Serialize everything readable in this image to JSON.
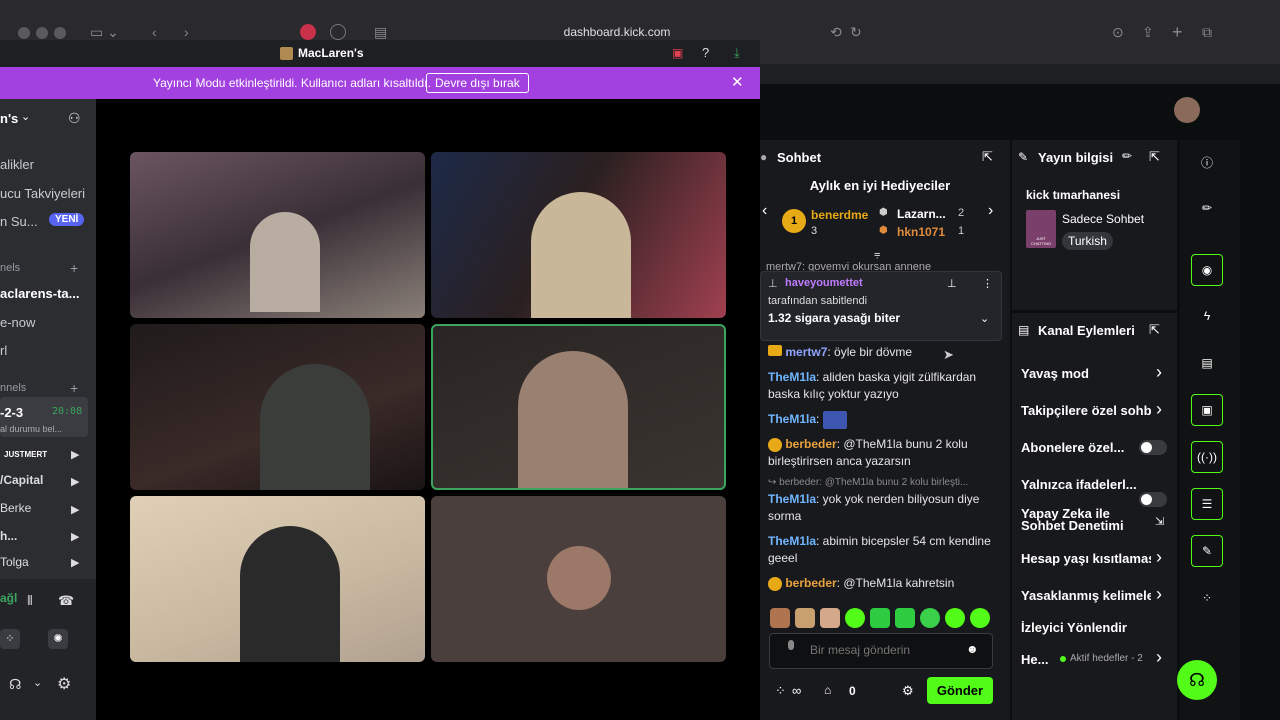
{
  "browser": {
    "url": "dashboard.kick.com"
  },
  "discord": {
    "window_title": "MacLaren's",
    "banner_text": "Yayıncı Modu etkinleştirildi. Kullanıcı adları kısaltıldı.",
    "banner_button": "Devre dışı bırak",
    "server_name": "n's",
    "sidebar": {
      "items": [
        "alikler",
        "ucu Takviyeleri",
        "n Su..."
      ],
      "new_badge": "YENİ",
      "section1": "nels",
      "channel_active": "aclarens-ta...",
      "ch2": "e-now",
      "ch3": "rl",
      "section2": "nnels",
      "voice_channel": "-2-3",
      "voice_time": "20:08",
      "voice_status": "al durumu bel...",
      "users": [
        "JUSTMERT",
        "/Capital",
        "Berke",
        "h...",
        "Tolga"
      ],
      "self_name": "ağl"
    }
  },
  "kick": {
    "chat": {
      "title": "Sohbet",
      "gifters_title": "Aylık en iyi Hediyeciler",
      "gifters": [
        {
          "rank": "1",
          "name": "benerdme",
          "count": "3"
        },
        {
          "rank": "2",
          "name": "Lazarn...",
          "count": "2"
        },
        {
          "rank": "3",
          "name": "hkn1071",
          "count": "1"
        }
      ],
      "partial_line": "mertw7: govemvi okursan annene",
      "pinned": {
        "user": "haveyoumettet",
        "by": "tarafından sabitlendi",
        "message": "1.32 sigara yasağı biter"
      },
      "messages": [
        {
          "user": "mertw7",
          "text": ": öyle bir dövme",
          "color": "#8fa4ff"
        },
        {
          "user": "TheM1la",
          "text": ": aliden baska yigit zülfikardan baska kılıç yoktur yazıyo",
          "color": "#6fb6ff"
        },
        {
          "user": "TheM1la",
          "text": ":",
          "color": "#6fb6ff"
        },
        {
          "user": "berbeder",
          "text": ": @TheM1la bunu 2 kolu birleştirirsen anca yazarsın",
          "color": "#e8a23d"
        },
        {
          "reply": "berbeder: @TheM1la bunu 2 kolu birleşti...",
          "user": "TheM1la",
          "text": ": yok yok nerden biliyosun diye sorma",
          "color": "#6fb6ff"
        },
        {
          "user": "TheM1la",
          "text": ": abimin bicepsler 54 cm kendine geeel",
          "color": "#6fb6ff"
        },
        {
          "user": "berbeder",
          "text": ": @TheM1la kahretsin",
          "color": "#e8a23d"
        }
      ],
      "input_placeholder": "Bir mesaj gönderin",
      "points": "0",
      "send_label": "Gönder"
    },
    "stream_info": {
      "title": "Yayın bilgisi",
      "stream_title": "kick tımarhanesi",
      "category": "Sadece Sohbet",
      "category_art_text": "JUST CHATTING",
      "language": "Turkish"
    },
    "actions": {
      "title": "Kanal Eylemleri",
      "items": [
        {
          "label": "Yavaş mod",
          "control": "chevron"
        },
        {
          "label": "Takipçilere özel sohbet",
          "control": "chevron"
        },
        {
          "label": "Abonelere özel...",
          "control": "toggle"
        },
        {
          "label": "Yalnızca ifadelerl...",
          "control": "toggle"
        },
        {
          "label": "Yapay Zeka ile Sohbet Denetimi",
          "control": "external"
        },
        {
          "label": "Hesap yaşı kısıtlaması",
          "control": "chevron"
        },
        {
          "label": "Yasaklanmış kelimeler",
          "control": "chevron"
        },
        {
          "label": "İzleyici Yönlendir",
          "control": "none"
        },
        {
          "label": "He...",
          "control": "chevron",
          "extra": "Aktif hedefler - 2"
        }
      ]
    }
  }
}
